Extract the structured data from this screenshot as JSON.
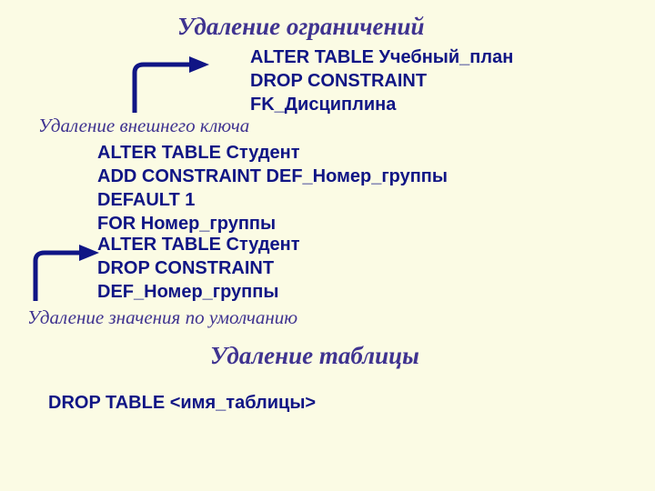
{
  "title1": "Удаление ограничений",
  "sql1_line1": "  ALTER TABLE Учебный_план",
  "sql1_line2": "  DROP CONSTRAINT",
  "sql1_line3": "FK_Дисциплина",
  "annot1": "Удаление внешнего ключа",
  "sql2_line1": "  ALTER TABLE Студент",
  "sql2_line2": "  ADD CONSTRAINT DEF_Номер_группы",
  "sql2_line3": "DEFAULT 1",
  "sql2_line4": "          FOR Номер_группы",
  "sql3_line1": "  ALTER TABLE Студент",
  "sql3_line2": "  DROP CONSTRAINT",
  "sql3_line3": "DEF_Номер_группы",
  "annot2": "Удаление значения по умолчанию",
  "title2": "Удаление таблицы",
  "sql4": "DROP TABLE <имя_таблицы>"
}
